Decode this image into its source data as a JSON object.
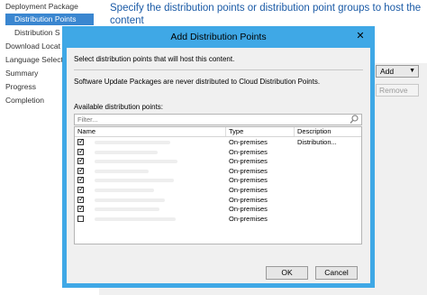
{
  "wizard": {
    "heading": "Specify the distribution points or distribution point groups to host the content",
    "nav": [
      {
        "label": "Deployment Package"
      },
      {
        "label": "Distribution Points"
      },
      {
        "label": "Distribution S"
      },
      {
        "label": "Download Locat"
      },
      {
        "label": "Language Select"
      },
      {
        "label": "Summary"
      },
      {
        "label": "Progress"
      },
      {
        "label": "Completion"
      }
    ],
    "add_label": "Add",
    "remove_label": "Remove"
  },
  "dialog": {
    "title": "Add Distribution Points",
    "close_glyph": "✕",
    "instruction": "Select distribution points that will host this content.",
    "note": "Software Update Packages are never distributed to Cloud Distribution Points.",
    "available_label": "Available distribution points:",
    "filter_placeholder": "Filter...",
    "columns": {
      "name": "Name",
      "type": "Type",
      "description": "Description"
    },
    "rows": [
      {
        "checked": true,
        "type": "On-premises",
        "description": "Distribution..."
      },
      {
        "checked": true,
        "type": "On-premises",
        "description": ""
      },
      {
        "checked": true,
        "type": "On-premises",
        "description": ""
      },
      {
        "checked": true,
        "type": "On-premises",
        "description": ""
      },
      {
        "checked": true,
        "type": "On-premises",
        "description": ""
      },
      {
        "checked": true,
        "type": "On-premises",
        "description": ""
      },
      {
        "checked": true,
        "type": "On-premises",
        "description": ""
      },
      {
        "checked": true,
        "type": "On-premises",
        "description": ""
      },
      {
        "checked": false,
        "type": "On-premises",
        "description": ""
      }
    ],
    "ok_label": "OK",
    "cancel_label": "Cancel"
  }
}
